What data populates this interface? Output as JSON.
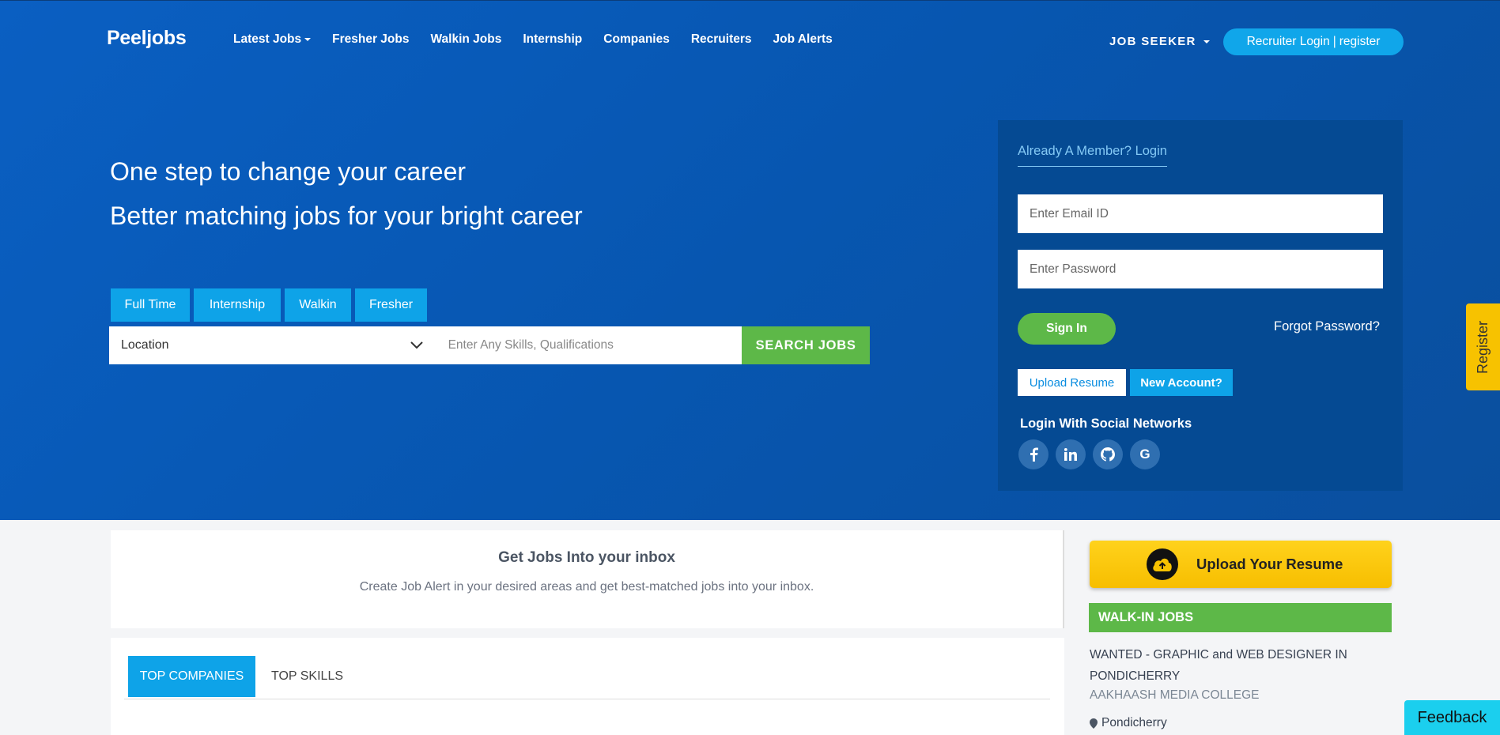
{
  "nav": {
    "logo": "Peeljobs",
    "items": [
      {
        "label": "Latest Jobs",
        "dropdown": true
      },
      {
        "label": "Fresher Jobs"
      },
      {
        "label": "Walkin Jobs"
      },
      {
        "label": "Internship"
      },
      {
        "label": "Companies"
      },
      {
        "label": "Recruiters"
      },
      {
        "label": "Job Alerts"
      }
    ],
    "seeker_label": "JOB SEEKER",
    "recruiter_login": "Recruiter Login",
    "recruiter_sep": "|",
    "recruiter_register": "register"
  },
  "hero": {
    "line1": "One step to change your career",
    "line2": "Better matching jobs for your bright career",
    "tabs": [
      "Full Time",
      "Internship",
      "Walkin",
      "Fresher"
    ],
    "location_value": "Location",
    "skills_placeholder": "Enter Any Skills, Qualifications",
    "search_button": "SEARCH JOBS"
  },
  "login": {
    "title": "Already A Member? Login",
    "email_placeholder": "Enter Email ID",
    "password_placeholder": "Enter Password",
    "signin": "Sign In",
    "forgot": "Forgot Password?",
    "upload_resume": "Upload Resume",
    "new_account": "New Account?",
    "social_label": "Login With Social Networks",
    "social_icons": [
      "facebook-icon",
      "linkedin-icon",
      "github-icon",
      "google-icon"
    ]
  },
  "register_tab": "Register",
  "alert": {
    "title": "Get Jobs Into your inbox",
    "subtitle": "Create Job Alert in your desired areas and get best-matched jobs into your inbox."
  },
  "tabs": {
    "active": "TOP COMPANIES",
    "inactive": "TOP SKILLS"
  },
  "sidebar": {
    "upload_resume": "Upload Your Resume",
    "walkin_heading": "WALK-IN JOBS",
    "walkin_job": {
      "title": "WANTED - GRAPHIC and WEB DESIGNER IN PONDICHERRY",
      "company": "AAKHAASH MEDIA COLLEGE",
      "location": "Pondicherry"
    }
  },
  "feedback": "Feedback",
  "colors": {
    "hero_bg": "#0a5fc2",
    "accent_blue": "#0ea3e8",
    "accent_green": "#5db848",
    "accent_yellow": "#f7c200"
  }
}
